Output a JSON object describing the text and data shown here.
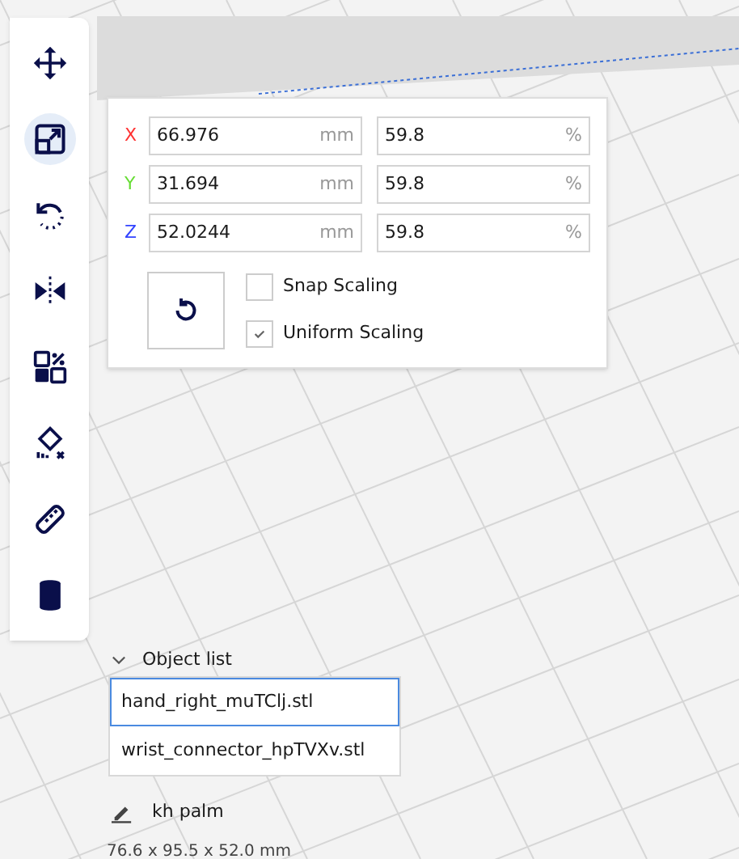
{
  "toolbar": {
    "tools": [
      {
        "kind": "move",
        "selected": false
      },
      {
        "kind": "scale",
        "selected": true
      },
      {
        "kind": "rotate",
        "selected": false
      },
      {
        "kind": "mirror",
        "selected": false
      },
      {
        "kind": "per-model",
        "selected": false
      },
      {
        "kind": "support",
        "selected": false
      },
      {
        "kind": "measure",
        "selected": false
      },
      {
        "kind": "cylinder",
        "selected": false
      }
    ]
  },
  "scale_panel": {
    "axes": [
      {
        "label": "X",
        "color": "#ff3333",
        "size": "66.976",
        "size_unit": "mm",
        "percent": "59.8",
        "percent_unit": "%"
      },
      {
        "label": "Y",
        "color": "#66dd33",
        "size": "31.694",
        "size_unit": "mm",
        "percent": "59.8",
        "percent_unit": "%"
      },
      {
        "label": "Z",
        "color": "#3344ff",
        "size": "52.0244",
        "size_unit": "mm",
        "percent": "59.8",
        "percent_unit": "%"
      }
    ],
    "options": [
      {
        "label": "Snap Scaling",
        "checked": false
      },
      {
        "label": "Uniform Scaling",
        "checked": true
      }
    ]
  },
  "object_list": {
    "title": "Object list",
    "expanded": true,
    "items": [
      {
        "name": "hand_right_muTClj.stl",
        "selected": true
      },
      {
        "name": "wrist_connector_hpTVXv.stl",
        "selected": false
      }
    ]
  },
  "job": {
    "name": "kh palm",
    "dimensions": "76.6 x 95.5 x 52.0 mm"
  }
}
